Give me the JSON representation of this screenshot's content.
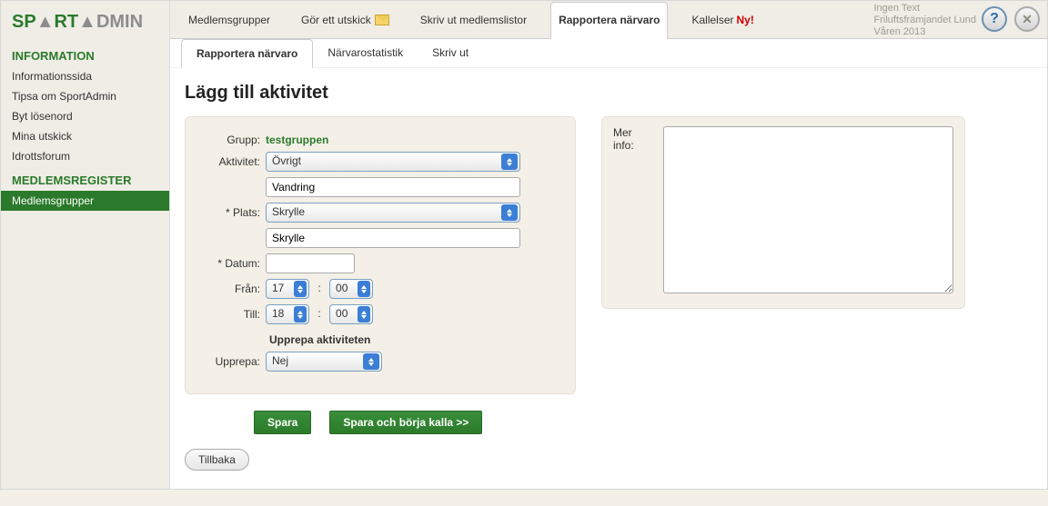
{
  "logo": {
    "part1": "SP",
    "part2": "▲",
    "part3": "RT",
    "part4": "▲",
    "part5": "DMIN"
  },
  "topnav": {
    "medlemsgrupper": "Medlemsgrupper",
    "gor_utskick": "Gör ett utskick",
    "skriv_ut_listor": "Skriv ut medlemslistor",
    "rapportera": "Rapportera närvaro",
    "kallelser": "Kallelser",
    "ny": "Ny!"
  },
  "user": {
    "line1": "Ingen Text",
    "line2": "Friluftsfrämjandet Lund",
    "line3": "Våren 2013"
  },
  "help_label": "?",
  "close_label": "✕",
  "sidebar": {
    "heading_info": "INFORMATION",
    "items_info": [
      "Informationssida",
      "Tipsa om SportAdmin",
      "Byt lösenord",
      "Mina utskick",
      "Idrottsforum"
    ],
    "heading_reg": "MEDLEMSREGISTER",
    "items_reg": [
      "Medlemsgrupper"
    ]
  },
  "subtabs": {
    "rapportera": "Rapportera närvaro",
    "narvaro": "Närvarostatistik",
    "skriv_ut": "Skriv ut"
  },
  "page_title": "Lägg till aktivitet",
  "form": {
    "grupp_label": "Grupp:",
    "grupp_value": "testgruppen",
    "aktivitet_label": "Aktivitet:",
    "aktivitet_select": "Övrigt",
    "aktivitet_text": "Vandring",
    "plats_label": "* Plats:",
    "plats_select": "Skrylle",
    "plats_text": "Skrylle",
    "datum_label": "* Datum:",
    "datum_value": "",
    "fran_label": "Från:",
    "fran_h": "17",
    "fran_m": "00",
    "till_label": "Till:",
    "till_h": "18",
    "till_m": "00",
    "upprepa_heading": "Upprepa aktiviteten",
    "upprepa_label": "Upprepa:",
    "upprepa_select": "Nej"
  },
  "info_panel": {
    "label": "Mer info:",
    "value": ""
  },
  "buttons": {
    "spara": "Spara",
    "spara_kalla": "Spara och börja kalla >>",
    "tillbaka": "Tillbaka"
  }
}
